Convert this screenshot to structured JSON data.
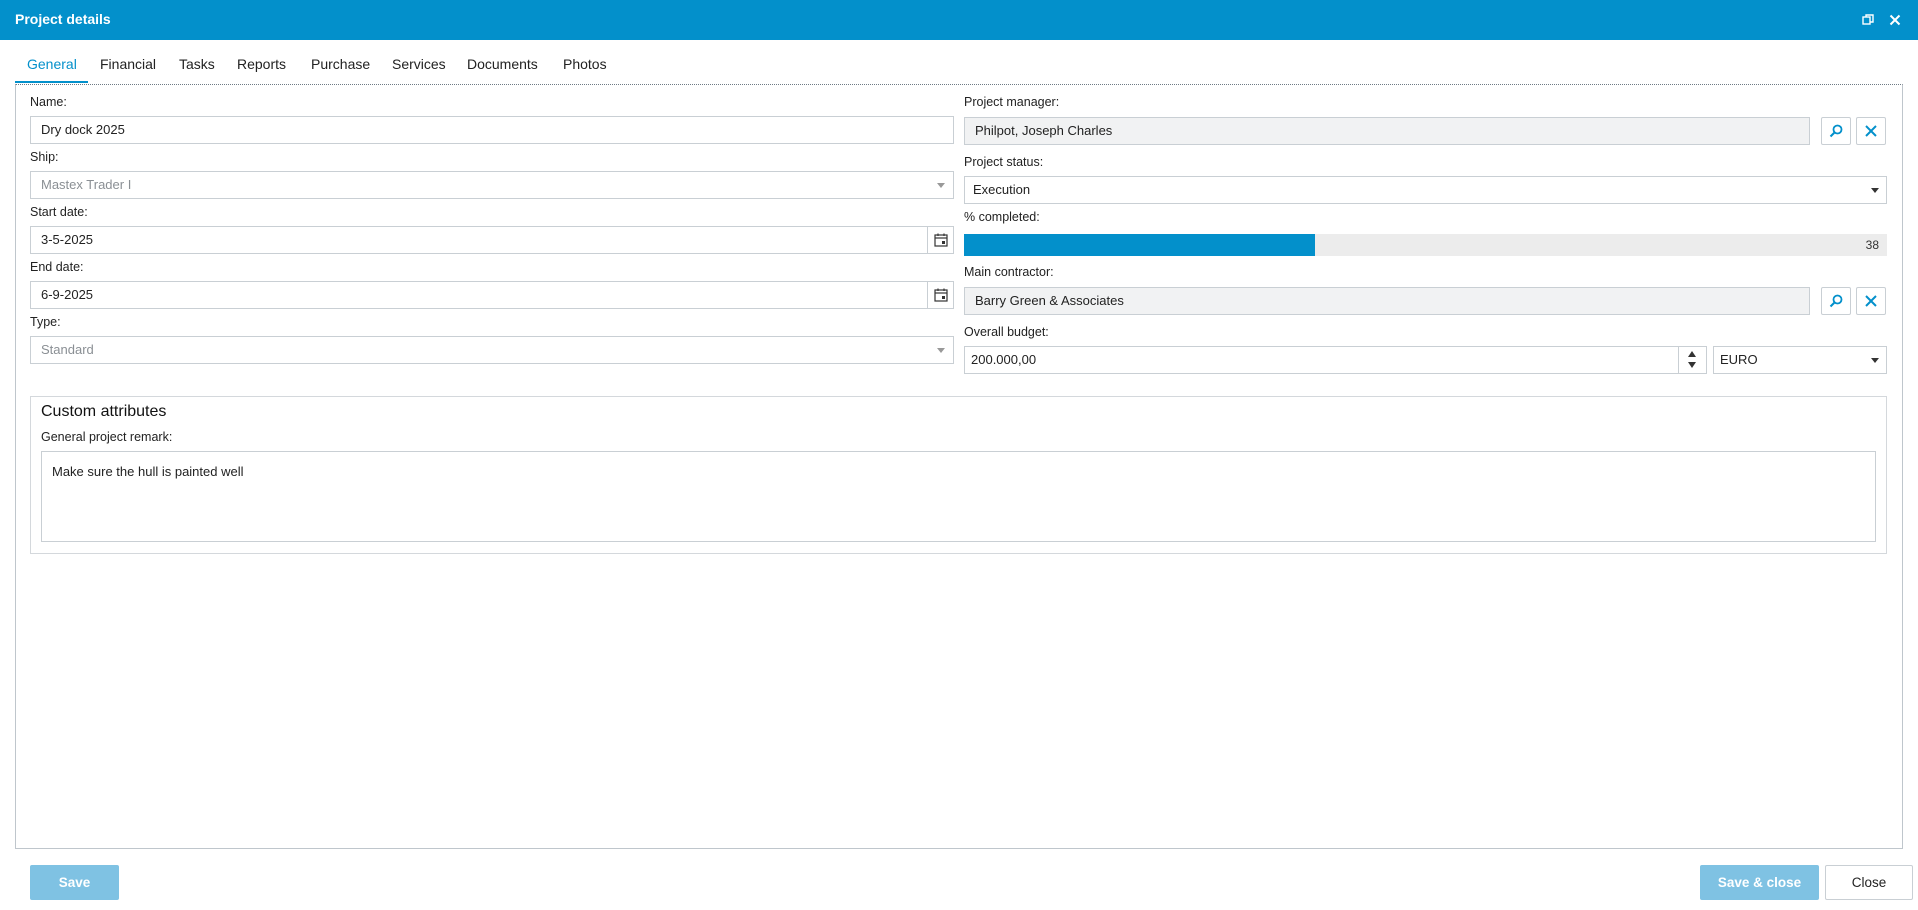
{
  "window": {
    "title": "Project details"
  },
  "tabs": [
    {
      "label": "General"
    },
    {
      "label": "Financial"
    },
    {
      "label": "Tasks"
    },
    {
      "label": "Reports"
    },
    {
      "label": "Purchase"
    },
    {
      "label": "Services"
    },
    {
      "label": "Documents"
    },
    {
      "label": "Photos"
    }
  ],
  "left": {
    "name": {
      "label": "Name:",
      "value": "Dry dock 2025"
    },
    "ship": {
      "label": "Ship:",
      "value": "Mastex Trader I"
    },
    "start_date": {
      "label": "Start date:",
      "value": "3-5-2025"
    },
    "end_date": {
      "label": "End date:",
      "value": "6-9-2025"
    },
    "type": {
      "label": "Type:",
      "value": "Standard"
    }
  },
  "right": {
    "project_manager": {
      "label": "Project manager:",
      "value": "Philpot, Joseph Charles"
    },
    "project_status": {
      "label": "Project status:",
      "value": "Execution"
    },
    "completed": {
      "label": "% completed:",
      "value": "38",
      "fraction": 0.38
    },
    "main_contractor": {
      "label": "Main contractor:",
      "value": "Barry Green & Associates"
    },
    "overall_budget": {
      "label": "Overall budget:",
      "value": "200.000,00",
      "currency": "EURO"
    }
  },
  "custom": {
    "title": "Custom attributes",
    "remark_label": "General project remark:",
    "remark_value": "Make sure the hull is painted well"
  },
  "footer": {
    "save_label": "Save",
    "save_close_label": "Save & close",
    "close_label": "Close"
  },
  "colors": {
    "accent": "#0390cb",
    "button_disabled": "#7fc2e3"
  }
}
